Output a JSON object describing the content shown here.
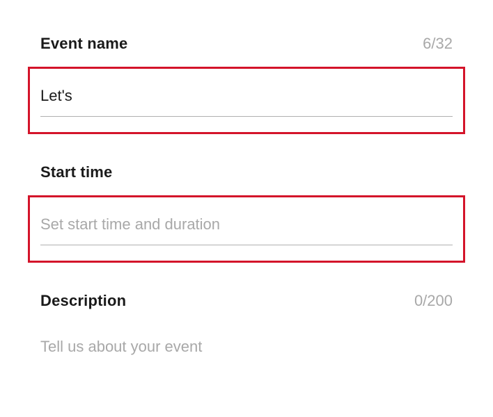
{
  "form": {
    "event_name": {
      "label": "Event name",
      "counter": "6/32",
      "value": "Let's"
    },
    "start_time": {
      "label": "Start time",
      "placeholder": "Set start time and duration"
    },
    "description": {
      "label": "Description",
      "counter": "0/200",
      "placeholder": "Tell us about your event"
    }
  }
}
